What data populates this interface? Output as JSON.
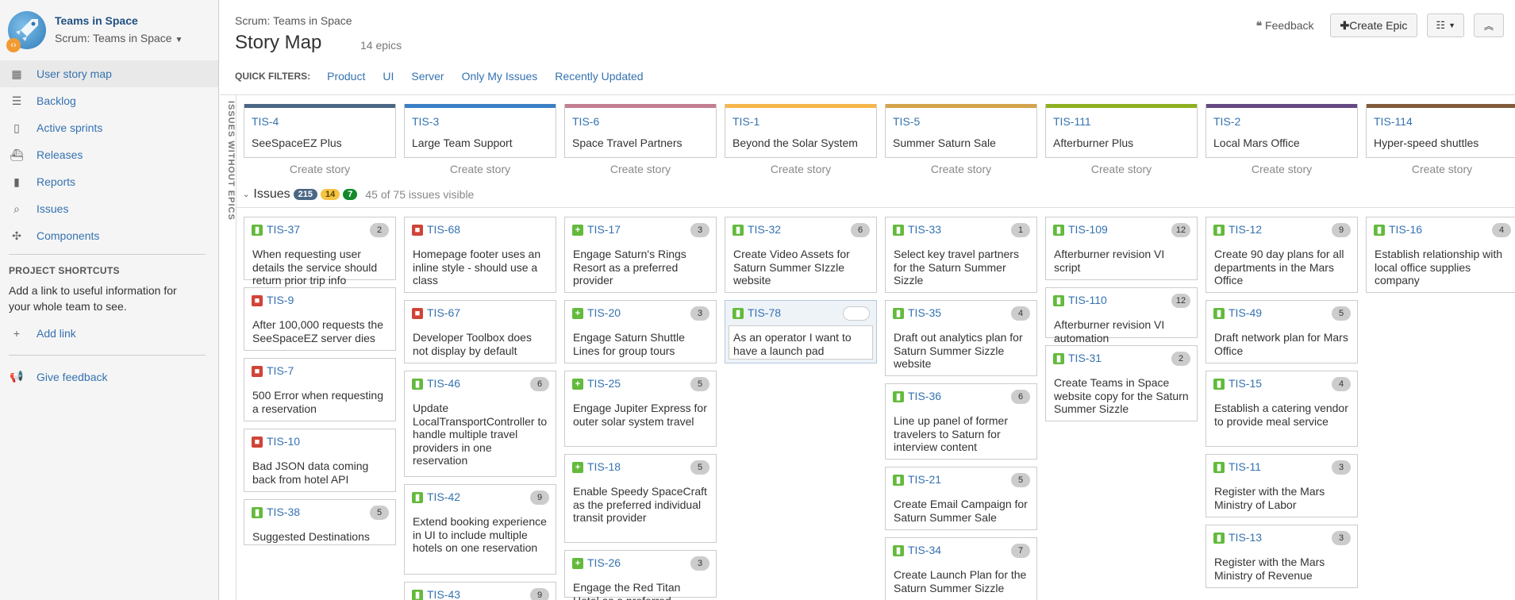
{
  "sidebar": {
    "project_name": "Teams in Space",
    "project_board": "Scrum: Teams in Space",
    "nav": [
      {
        "label": "User story map",
        "icon": "story-map-icon",
        "active": true
      },
      {
        "label": "Backlog",
        "icon": "backlog-icon"
      },
      {
        "label": "Active sprints",
        "icon": "sprints-icon"
      },
      {
        "label": "Releases",
        "icon": "releases-icon"
      },
      {
        "label": "Reports",
        "icon": "reports-icon"
      },
      {
        "label": "Issues",
        "icon": "issues-icon"
      },
      {
        "label": "Components",
        "icon": "components-icon"
      }
    ],
    "shortcuts_heading": "PROJECT SHORTCUTS",
    "shortcuts_text": "Add a link to useful information for your whole team to see.",
    "add_link": "Add link",
    "give_feedback": "Give feedback"
  },
  "header": {
    "breadcrumb": "Scrum: Teams in Space",
    "title": "Story Map",
    "epic_count": "14 epics",
    "feedback": "Feedback",
    "create_epic": "Create Epic"
  },
  "quick_filters": {
    "label": "QUICK FILTERS:",
    "items": [
      "Product",
      "UI",
      "Server",
      "Only My Issues",
      "Recently Updated"
    ]
  },
  "vertical_label": "ISSUES WITHOUT EPICS",
  "epics": [
    {
      "key": "TIS-4",
      "title": "SeeSpaceEZ Plus",
      "create": "Create story",
      "color": "#4a6785"
    },
    {
      "key": "TIS-3",
      "title": "Large Team Support",
      "create": "Create story",
      "color": "#3b7fc4"
    },
    {
      "key": "TIS-6",
      "title": "Space Travel Partners",
      "create": "Create story",
      "color": "#c37e91"
    },
    {
      "key": "TIS-1",
      "title": "Beyond the Solar System",
      "create": "Create story",
      "color": "#f6b74b"
    },
    {
      "key": "TIS-5",
      "title": "Summer Saturn Sale",
      "create": "Create story",
      "color": "#d4a34a"
    },
    {
      "key": "TIS-111",
      "title": "Afterburner Plus",
      "create": "Create story",
      "color": "#8eb021"
    },
    {
      "key": "TIS-2",
      "title": "Local Mars Office",
      "create": "Create story",
      "color": "#654982"
    },
    {
      "key": "TIS-114",
      "title": "Hyper-speed shuttles",
      "create": "Create story",
      "color": "#815b3a"
    }
  ],
  "issues_summary": {
    "label": "Issues",
    "counts": [
      {
        "value": "215",
        "color": "#4a6785"
      },
      {
        "value": "14",
        "color": "#f6c342"
      },
      {
        "value": "7",
        "color": "#14892c"
      }
    ],
    "visible": "45 of 75 issues visible"
  },
  "columns": [
    [
      {
        "key": "TIS-37",
        "type": "story",
        "points": "2",
        "summary": "When requesting user details the service should return prior trip info"
      },
      {
        "key": "TIS-9",
        "type": "bug",
        "points": "",
        "summary": "After 100,000 requests the SeeSpaceEZ server dies"
      },
      {
        "key": "TIS-7",
        "type": "bug",
        "points": "",
        "summary": "500 Error when requesting a reservation"
      },
      {
        "key": "TIS-10",
        "type": "bug",
        "points": "",
        "summary": "Bad JSON data coming back from hotel API"
      },
      {
        "key": "TIS-38",
        "type": "story",
        "points": "5",
        "summary": "Suggested Destinations"
      }
    ],
    [
      {
        "key": "TIS-68",
        "type": "bug",
        "points": "",
        "summary": "Homepage footer uses an inline style - should use a class"
      },
      {
        "key": "TIS-67",
        "type": "bug",
        "points": "",
        "summary": "Developer Toolbox does not display by default"
      },
      {
        "key": "TIS-46",
        "type": "story",
        "points": "6",
        "summary": "Update LocalTransportController to handle multiple travel providers in one reservation"
      },
      {
        "key": "TIS-42",
        "type": "story",
        "points": "9",
        "summary": "Extend booking experience in UI to include multiple hotels on one reservation"
      },
      {
        "key": "TIS-43",
        "type": "story",
        "points": "9",
        "summary": ""
      }
    ],
    [
      {
        "key": "TIS-17",
        "type": "improvement",
        "points": "3",
        "summary": "Engage Saturn's Rings Resort as a preferred provider"
      },
      {
        "key": "TIS-20",
        "type": "improvement",
        "points": "3",
        "summary": "Engage Saturn Shuttle Lines for group tours"
      },
      {
        "key": "TIS-25",
        "type": "improvement",
        "points": "5",
        "summary": "Engage Jupiter Express for outer solar system travel"
      },
      {
        "key": "TIS-18",
        "type": "improvement",
        "points": "5",
        "summary": "Enable Speedy SpaceCraft as the preferred individual transit provider"
      },
      {
        "key": "TIS-26",
        "type": "improvement",
        "points": "3",
        "summary": "Engage the Red Titan Hotel as a preferred"
      }
    ],
    [
      {
        "key": "TIS-32",
        "type": "story",
        "points": "6",
        "summary": "Create Video Assets for Saturn Summer SIzzle website"
      },
      {
        "key": "TIS-78",
        "type": "story",
        "points": "",
        "summary": "As an operator I want to have a launch pad",
        "selected": true
      }
    ],
    [
      {
        "key": "TIS-33",
        "type": "story",
        "points": "1",
        "summary": "Select key travel partners for the Saturn Summer Sizzle"
      },
      {
        "key": "TIS-35",
        "type": "story",
        "points": "4",
        "summary": "Draft out analytics plan for Saturn Summer Sizzle website"
      },
      {
        "key": "TIS-36",
        "type": "story",
        "points": "6",
        "summary": "Line up panel of former travelers to Saturn for interview content"
      },
      {
        "key": "TIS-21",
        "type": "story",
        "points": "5",
        "summary": "Create Email Campaign for Saturn Summer Sale"
      },
      {
        "key": "TIS-34",
        "type": "story",
        "points": "7",
        "summary": "Create Launch Plan for the Saturn Summer Sizzle"
      }
    ],
    [
      {
        "key": "TIS-109",
        "type": "story",
        "points": "12",
        "summary": "Afterburner revision VI script"
      },
      {
        "key": "TIS-110",
        "type": "story",
        "points": "12",
        "summary": "Afterburner revision VI automation"
      },
      {
        "key": "TIS-31",
        "type": "story",
        "points": "2",
        "summary": "Create Teams in Space website copy for the Saturn Summer Sizzle"
      }
    ],
    [
      {
        "key": "TIS-12",
        "type": "story",
        "points": "9",
        "summary": "Create 90 day plans for all departments in the Mars Office"
      },
      {
        "key": "TIS-49",
        "type": "story",
        "points": "5",
        "summary": "Draft network plan for Mars Office"
      },
      {
        "key": "TIS-15",
        "type": "story",
        "points": "4",
        "summary": "Establish a catering vendor to provide meal service"
      },
      {
        "key": "TIS-11",
        "type": "story",
        "points": "3",
        "summary": "Register with the Mars Ministry of Labor"
      },
      {
        "key": "TIS-13",
        "type": "story",
        "points": "3",
        "summary": "Register with the Mars Ministry of Revenue"
      }
    ],
    [
      {
        "key": "TIS-16",
        "type": "story",
        "points": "4",
        "summary": "Establish relationship with local office supplies company"
      }
    ]
  ]
}
